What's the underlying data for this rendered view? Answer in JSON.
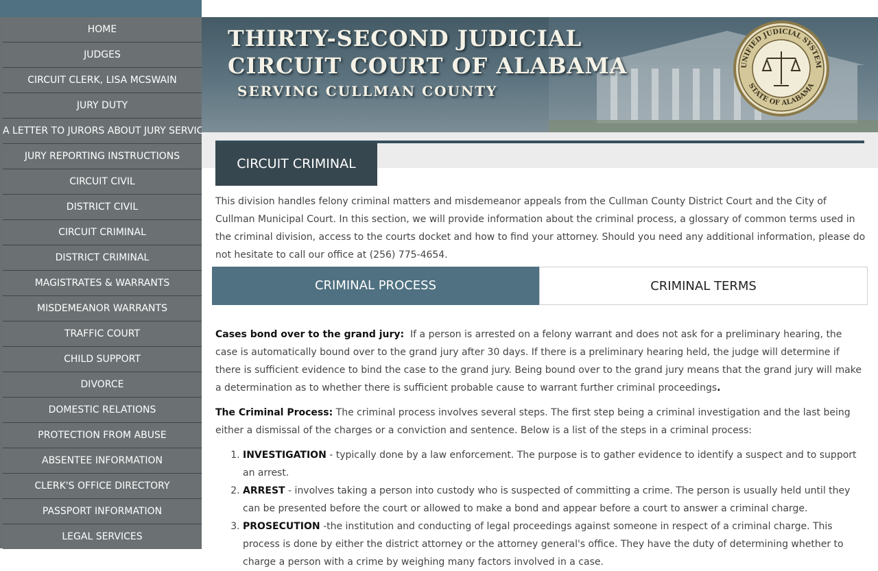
{
  "sidebar": {
    "items": [
      {
        "label": "HOME"
      },
      {
        "label": "JUDGES"
      },
      {
        "label": "CIRCUIT CLERK, LISA MCSWAIN"
      },
      {
        "label": "JURY DUTY"
      },
      {
        "label": "A LETTER TO JURORS ABOUT JURY SERVICE"
      },
      {
        "label": "JURY REPORTING INSTRUCTIONS"
      },
      {
        "label": "CIRCUIT CIVIL"
      },
      {
        "label": "DISTRICT CIVIL"
      },
      {
        "label": "CIRCUIT CRIMINAL"
      },
      {
        "label": "DISTRICT CRIMINAL"
      },
      {
        "label": "MAGISTRATES & WARRANTS"
      },
      {
        "label": "MISDEMEANOR WARRANTS"
      },
      {
        "label": "TRAFFIC COURT"
      },
      {
        "label": "CHILD SUPPORT"
      },
      {
        "label": "DIVORCE"
      },
      {
        "label": "DOMESTIC RELATIONS"
      },
      {
        "label": "PROTECTION FROM ABUSE"
      },
      {
        "label": "ABSENTEE INFORMATION"
      },
      {
        "label": "CLERK'S OFFICE DIRECTORY"
      },
      {
        "label": "PASSPORT INFORMATION"
      },
      {
        "label": "LEGAL SERVICES"
      }
    ]
  },
  "banner": {
    "line1": "THIRTY-SECOND JUDICIAL",
    "line2": "CIRCUIT COURT OF ALABAMA",
    "line3": "SERVING CULLMAN COUNTY",
    "seal_top": "UNIFIED JUDICIAL SYSTEM",
    "seal_bottom": "STATE OF ALABAMA"
  },
  "section": {
    "title": "CIRCUIT CRIMINAL",
    "intro": "This division handles felony criminal matters and misdemeanor appeals from the Cullman County District Court and the City of Cullman Municipal Court. In this section, we will provide information about the criminal process, a glossary of common terms used in the criminal division, access to the courts docket and how to find your attorney. Should you need any additional information, please do not hesitate to call our office at (256) 775-4654."
  },
  "tabs": {
    "process": "CRIMINAL PROCESS",
    "terms": "CRIMINAL TERMS"
  },
  "content": {
    "grand_jury_heading": "Cases bond over to the grand jury:",
    "grand_jury_text": "If a person is arrested on a felony warrant and does not ask for a preliminary hearing, the case is automatically bound over to the grand jury after 30 days. If there is a preliminary hearing held, the judge will determine if there is sufficient evidence to bind the case to the grand jury. Being bound over to the grand jury means that the grand jury will make a determination as to whether there is sufficient probable cause to warrant further criminal proceedings",
    "grand_jury_end": ".",
    "process_heading": "The Criminal Process:",
    "process_text": "The criminal process involves several steps. The first step being a criminal investigation and the last being either a dismissal of the charges or a conviction and sentence. Below is a list of the steps in a criminal process:",
    "steps": [
      {
        "term": "INVESTIGATION",
        "text": "- typically done by a law enforcement. The purpose is to gather evidence to identify a suspect and to support an arrest."
      },
      {
        "term": "ARREST",
        "text": "- involves taking a person into custody who is suspected of committing a crime.  The person is usually held until they can be presented before the court or allowed to make a bond and appear before a court to answer a criminal charge."
      },
      {
        "term": "PROSECUTION",
        "text": "-the institution and conducting of legal proceedings against someone in respect of a criminal charge.  This process is done by either the district attorney or the attorney general's office. They have the duty of determining whether to charge a person with a crime by weighing many factors involved in a case."
      }
    ]
  },
  "colors": {
    "sidebar": "#6b7173",
    "accent": "#4f7181",
    "section_tab": "#37474f"
  }
}
